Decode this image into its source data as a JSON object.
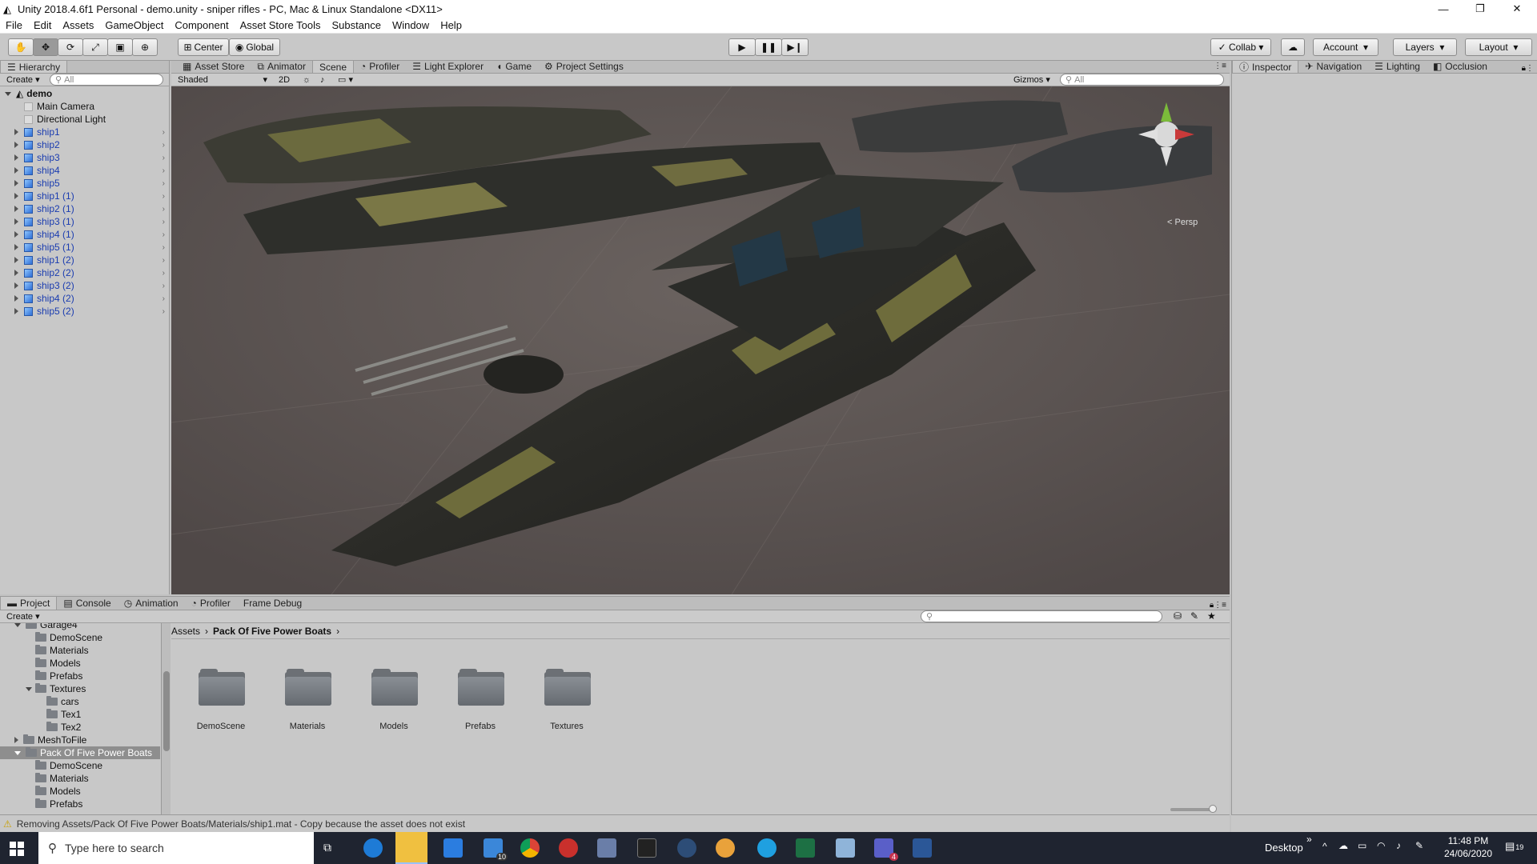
{
  "window": {
    "title": "Unity 2018.4.6f1 Personal - demo.unity - sniper rifles - PC, Mac & Linux Standalone <DX11>"
  },
  "menu": [
    "File",
    "Edit",
    "Assets",
    "GameObject",
    "Component",
    "Asset Store Tools",
    "Substance",
    "Window",
    "Help"
  ],
  "toolbar": {
    "center_label": "Center",
    "global_label": "Global",
    "collab_label": "Collab",
    "account_label": "Account",
    "layers_label": "Layers",
    "layout_label": "Layout"
  },
  "hierarchy": {
    "tab": "Hierarchy",
    "create": "Create",
    "search_placeholder": "All",
    "scene": "demo",
    "items": [
      "Main Camera",
      "Directional Light",
      "ship1",
      "ship2",
      "ship3",
      "ship4",
      "ship5",
      "ship1 (1)",
      "ship2 (1)",
      "ship3 (1)",
      "ship4 (1)",
      "ship5 (1)",
      "ship1 (2)",
      "ship2 (2)",
      "ship3 (2)",
      "ship4 (2)",
      "ship5 (2)"
    ]
  },
  "scene_tabs": [
    "Asset Store",
    "Animator",
    "Scene",
    "Profiler",
    "Light Explorer",
    "Game",
    "Project Settings"
  ],
  "scene_bar": {
    "shading": "Shaded",
    "mode2d": "2D",
    "gizmos": "Gizmos",
    "search_placeholder": "All",
    "persp": "Persp"
  },
  "inspector_tabs": [
    "Inspector",
    "Navigation",
    "Lighting",
    "Occlusion"
  ],
  "project": {
    "tabs": [
      "Project",
      "Console",
      "Animation",
      "Profiler",
      "Frame Debug"
    ],
    "create": "Create",
    "tree": [
      "Garage4",
      "DemoScene",
      "Materials",
      "Models",
      "Prefabs",
      "Textures",
      "cars",
      "Tex1",
      "Tex2",
      "MeshToFile",
      "Pack Of Five Power Boats",
      "DemoScene",
      "Materials",
      "Models",
      "Prefabs"
    ],
    "breadcrumb": {
      "root": "Assets",
      "current": "Pack Of Five Power Boats"
    },
    "folders": [
      "DemoScene",
      "Materials",
      "Models",
      "Prefabs",
      "Textures"
    ]
  },
  "status": {
    "message": "Removing Assets/Pack Of Five Power Boats/Materials/ship1.mat - Copy because the asset does not exist"
  },
  "taskbar": {
    "search_placeholder": "Type here to search",
    "desktop_label": "Desktop",
    "time": "11:48 PM",
    "date": "24/06/2020",
    "mail_badge": "10",
    "teams_badge": "4",
    "notif_count": "19"
  },
  "colors": {
    "unity_grey": "#c8c8c8",
    "selection": "#3b77c9",
    "taskbar": "#1f2430"
  }
}
